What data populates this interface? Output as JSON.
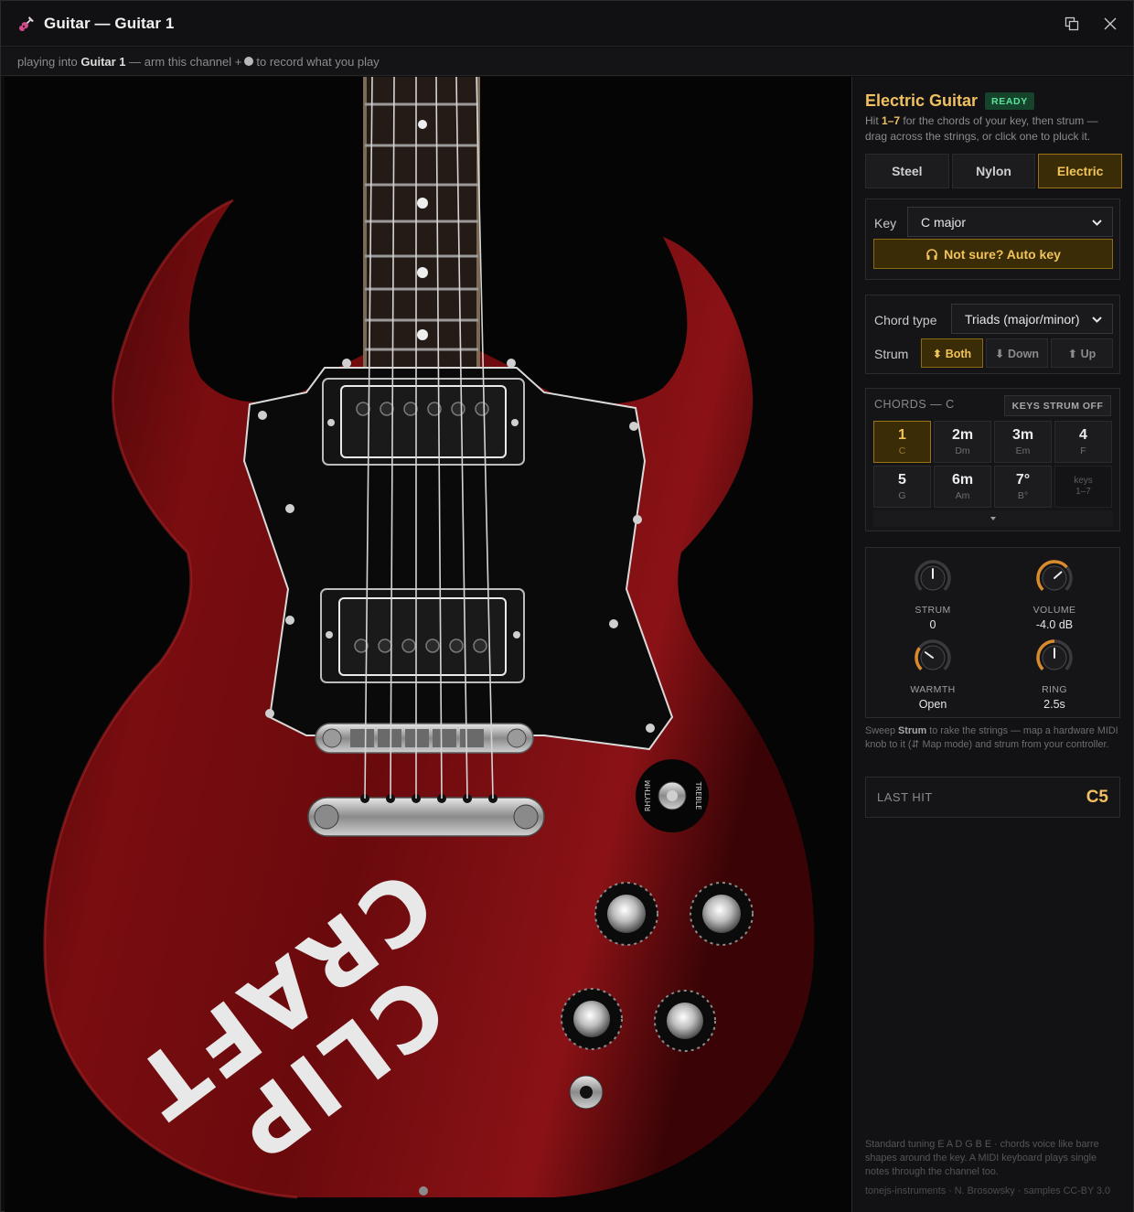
{
  "window": {
    "title": "Guitar — Guitar 1",
    "icon": "guitar-icon"
  },
  "subbar": {
    "prefix": "playing into",
    "channel": "Guitar 1",
    "middle": "— arm this channel +",
    "suffix": "to record what you play"
  },
  "instrument": {
    "name": "Electric Guitar",
    "status": "READY",
    "help_prefix": "Hit",
    "help_keys": "1–7",
    "help_suffix": "for the chords of your key, then strum — drag across the strings, or click one to pluck it."
  },
  "tones": [
    {
      "label": "Steel",
      "active": false
    },
    {
      "label": "Nylon",
      "active": false
    },
    {
      "label": "Electric",
      "active": true
    }
  ],
  "key": {
    "label": "Key",
    "value": "C major",
    "autokey_label": "Not sure? Auto key"
  },
  "chord_type": {
    "label": "Chord type",
    "value": "Triads (major/minor)"
  },
  "strum": {
    "label": "Strum",
    "options": [
      {
        "label": "⬍ Both",
        "active": true
      },
      {
        "label": "⬇ Down",
        "active": false
      },
      {
        "label": "⬆ Up",
        "active": false
      }
    ]
  },
  "chords": {
    "header": "CHORDS — C",
    "keys_strum": "KEYS STRUM OFF",
    "items": [
      {
        "degree": "1",
        "name": "C",
        "active": true
      },
      {
        "degree": "2m",
        "name": "Dm",
        "active": false
      },
      {
        "degree": "3m",
        "name": "Em",
        "active": false
      },
      {
        "degree": "4",
        "name": "F",
        "active": false
      },
      {
        "degree": "5",
        "name": "G",
        "active": false
      },
      {
        "degree": "6m",
        "name": "Am",
        "active": false
      },
      {
        "degree": "7°",
        "name": "B°",
        "active": false
      }
    ],
    "keys_hint_line1": "keys",
    "keys_hint_line2": "1–7"
  },
  "knobs": [
    {
      "label": "STRUM",
      "value": "0",
      "level": 0.5,
      "accent": false
    },
    {
      "label": "VOLUME",
      "value": "-4.0 dB",
      "level": 0.68,
      "accent": true
    },
    {
      "label": "WARMTH",
      "value": "Open",
      "level": 0.3,
      "accent": true
    },
    {
      "label": "RING",
      "value": "2.5s",
      "level": 0.5,
      "accent": true
    }
  ],
  "sweep_note": {
    "prefix": "Sweep",
    "word": "Strum",
    "suffix": "to rake the strings — map a hardware MIDI knob to it (⇵ Map mode) and strum from your controller."
  },
  "last_hit": {
    "label": "LAST HIT",
    "value": "C5"
  },
  "footer": {
    "note": "Standard tuning E A D G B E · chords voice like barre shapes around the key. A MIDI keyboard plays single notes through the channel too.",
    "credit": "tonejs-instruments · N. Brosowsky · samples CC-BY 3.0"
  },
  "guitar": {
    "toggle_left": "RHYTHM",
    "toggle_right": "TREBLE",
    "logo_line1": "CLIP",
    "logo_line2": "CRAFT"
  },
  "colors": {
    "accent": "#f0c060",
    "ready": "#5de29a",
    "body": "#7a0d10"
  }
}
